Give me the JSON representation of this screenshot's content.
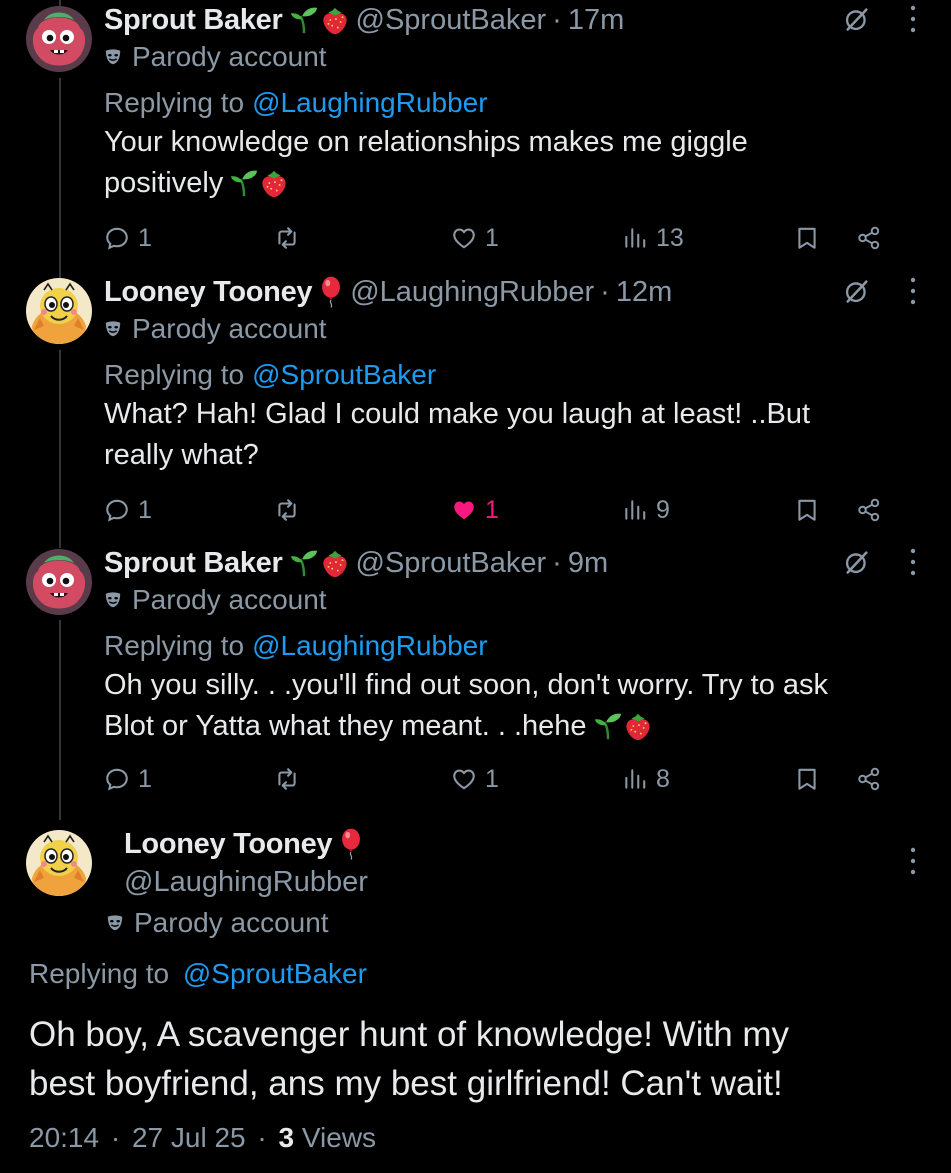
{
  "replies": [
    {
      "name": "Sprout Baker",
      "name_emojis": [
        "seedling-emoji",
        "strawberry-emoji"
      ],
      "handle": "@SproutBaker",
      "sep": "·",
      "time": "17m",
      "parody": "Parody account",
      "replying_label": "Replying to",
      "replying_mention": "@LaughingRubber",
      "text_line1": "Your knowledge on relationships makes me giggle",
      "text_line2": "positively",
      "text_emojis": [
        "seedling-emoji",
        "strawberry-emoji"
      ],
      "reply_count": "1",
      "repost_count": "",
      "like_count": "1",
      "liked": false,
      "views": "13"
    },
    {
      "name": "Looney Tooney",
      "name_emojis": [
        "balloon-emoji"
      ],
      "handle": "@LaughingRubber",
      "sep": "·",
      "time": "12m",
      "parody": "Parody account",
      "replying_label": "Replying to",
      "replying_mention": "@SproutBaker",
      "text_line1": "What? Hah! Glad I could make you laugh at least! ..But",
      "text_line2": "really what?",
      "text_emojis": [],
      "reply_count": "1",
      "repost_count": "",
      "like_count": "1",
      "liked": true,
      "views": "9"
    },
    {
      "name": "Sprout Baker",
      "name_emojis": [
        "seedling-emoji",
        "strawberry-emoji"
      ],
      "handle": "@SproutBaker",
      "sep": "·",
      "time": "9m",
      "parody": "Parody account",
      "replying_label": "Replying to",
      "replying_mention": "@LaughingRubber",
      "text_line1": "Oh you silly. . .you'll find out soon, don't worry. Try to ask",
      "text_line2": "Blot or Yatta what they meant. . .hehe",
      "text_emojis": [
        "seedling-emoji",
        "strawberry-emoji"
      ],
      "reply_count": "1",
      "repost_count": "",
      "like_count": "1",
      "liked": false,
      "views": "8"
    }
  ],
  "main": {
    "name": "Looney Tooney",
    "name_emojis": [
      "balloon-emoji"
    ],
    "handle": "@LaughingRubber",
    "parody": "Parody account",
    "replying_label": "Replying to",
    "replying_mention": "@SproutBaker",
    "text_line1": "Oh boy, A scavenger hunt of knowledge! With my",
    "text_line2": "best boyfriend, ans my best girlfriend! Can't wait!",
    "time": "20:14",
    "sep": "·",
    "date": "27 Jul 25",
    "views_count": "3",
    "views_label": "Views"
  },
  "colors": {
    "background": "#000000",
    "text": "#e7e9ea",
    "muted": "#8b98a5",
    "link": "#1d9bf0",
    "like": "#f91880"
  }
}
